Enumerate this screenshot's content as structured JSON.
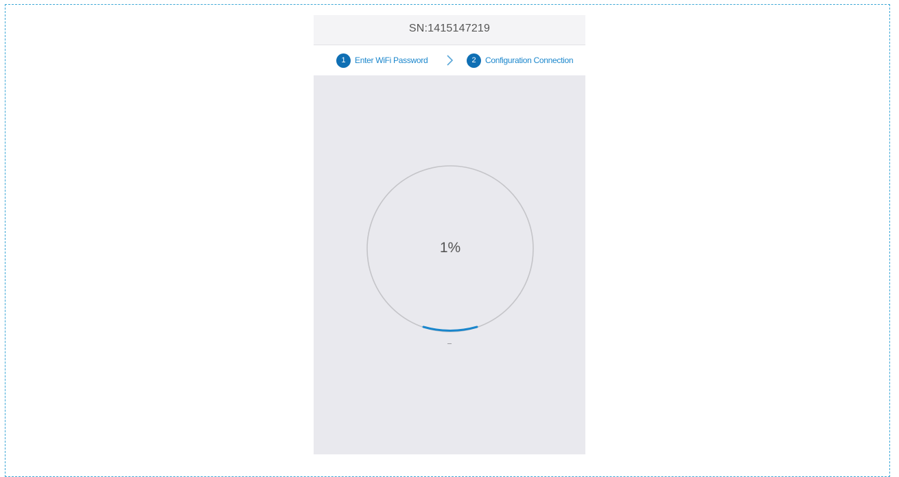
{
  "device": {
    "serial_label": "SN:1415147219"
  },
  "steps": [
    {
      "number": "1",
      "label": "Enter WiFi Password",
      "state": "done"
    },
    {
      "number": "2",
      "label": "Configuration Connection",
      "state": "active"
    }
  ],
  "progress": {
    "percent_text": "1%",
    "value_percent": 1
  },
  "colors": {
    "accent": "#1a86cc",
    "step_badge": "#0f6fb4",
    "background": "#e9e9ee",
    "border_dashed": "#3aa6d6"
  }
}
